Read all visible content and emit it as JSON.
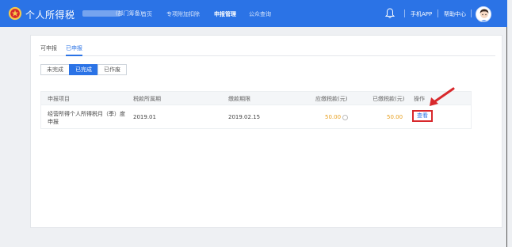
{
  "app": {
    "title": "个人所得税",
    "user_suffix": "(部门筹备)",
    "nav": [
      "首页",
      "专项附加扣除",
      "申报管理",
      "公众查询"
    ],
    "nav_active": 2,
    "mobile_app": "手机APP",
    "help_center": "帮助中心"
  },
  "tabs": [
    "可申报",
    "已申报"
  ],
  "active_tab": 1,
  "subtabs": [
    "未完成",
    "已完成",
    "已作废"
  ],
  "active_subtab": 1,
  "table": {
    "headers": [
      "申报项目",
      "税款所属期",
      "缴款期限",
      "应缴税款(元)",
      "已缴税款(元)",
      "操作"
    ],
    "rows": [
      {
        "item_line1": "经营所得个人所得税月（季）度",
        "item_line2": "申报",
        "period": "2019.01",
        "deadline": "2019.02.15",
        "tax_due": "50.00",
        "tax_paid": "50.00",
        "action": "查看"
      }
    ]
  },
  "colors": {
    "brand": "#2b73e6",
    "highlight": "#d8282c",
    "amount": "#e8a020"
  }
}
